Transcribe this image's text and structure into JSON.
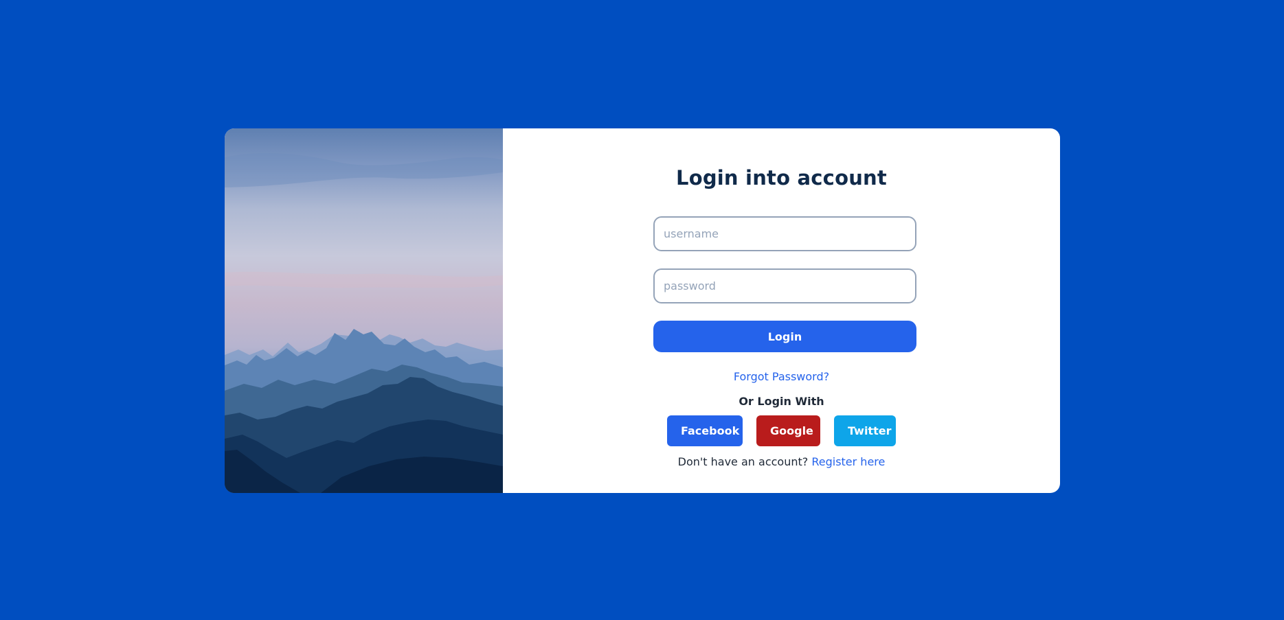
{
  "colors": {
    "background": "#004ec0",
    "card": "#ffffff",
    "primary": "#2563eb",
    "google": "#b91c1c",
    "twitter": "#0ea5e9",
    "title": "#102a4a"
  },
  "hero": {
    "image": "mountain-landscape"
  },
  "login": {
    "title": "Login into account",
    "username_placeholder": "username",
    "password_placeholder": "password",
    "login_button": "Login",
    "forgot_link": "Forgot Password?",
    "or_text": "Or Login With",
    "social": {
      "facebook": "Facebook",
      "google": "Google",
      "twitter": "Twitter"
    },
    "register_prompt": "Don't have an account?",
    "register_link": "Register here"
  }
}
